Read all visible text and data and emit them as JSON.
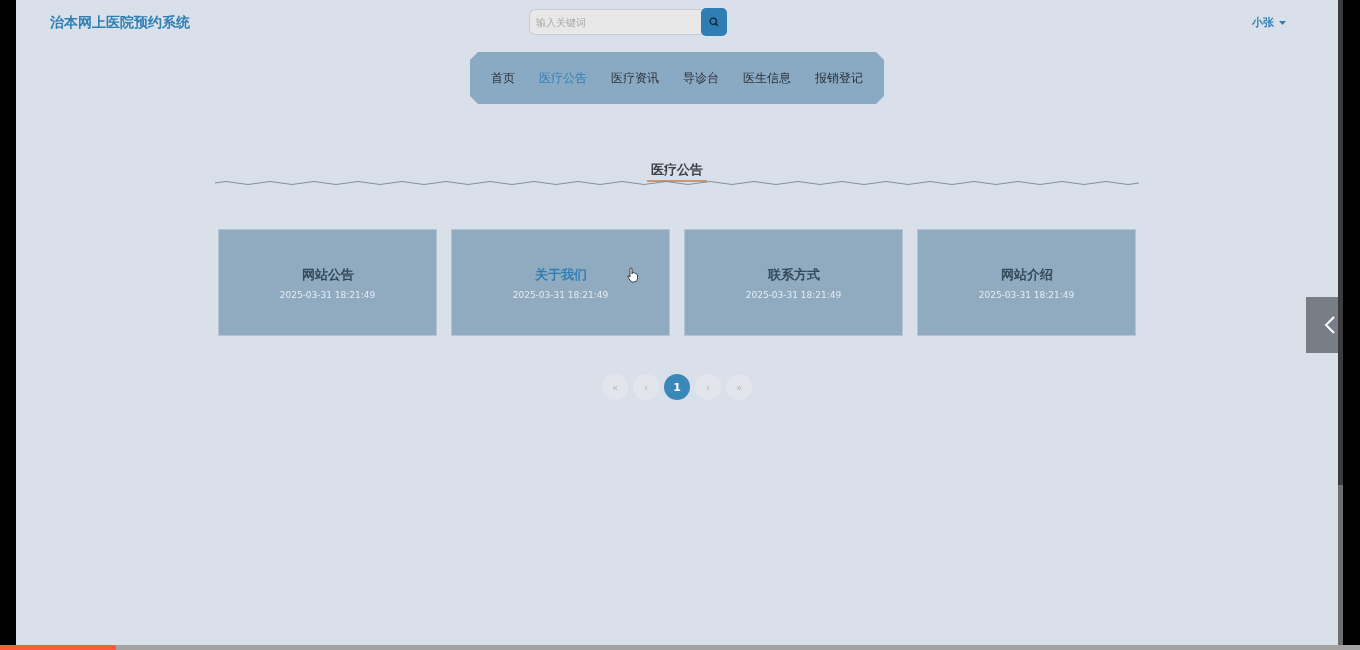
{
  "header": {
    "logo": "治本网上医院预约系统",
    "search": {
      "placeholder": "输入关键词"
    },
    "user": "小张"
  },
  "nav": [
    {
      "label": "首页",
      "selected": false
    },
    {
      "label": "医疗公告",
      "selected": true
    },
    {
      "label": "医疗资讯",
      "selected": false
    },
    {
      "label": "导诊台",
      "selected": false
    },
    {
      "label": "医生信息",
      "selected": false
    },
    {
      "label": "报销登记",
      "selected": false
    }
  ],
  "section_title": "医疗公告",
  "cards": [
    {
      "title": "网站公告",
      "date": "2025-03-31 18:21:49",
      "hovered": false
    },
    {
      "title": "关于我们",
      "date": "2025-03-31 18:21:49",
      "hovered": true
    },
    {
      "title": "联系方式",
      "date": "2025-03-31 18:21:49",
      "hovered": false
    },
    {
      "title": "网站介绍",
      "date": "2025-03-31 18:21:49",
      "hovered": false
    }
  ],
  "pagination": [
    {
      "label": "«",
      "selected": false
    },
    {
      "label": "‹",
      "selected": false
    },
    {
      "label": "1",
      "selected": true
    },
    {
      "label": "›",
      "selected": false
    },
    {
      "label": "»",
      "selected": false
    }
  ],
  "playback": {
    "level": 0.085
  }
}
